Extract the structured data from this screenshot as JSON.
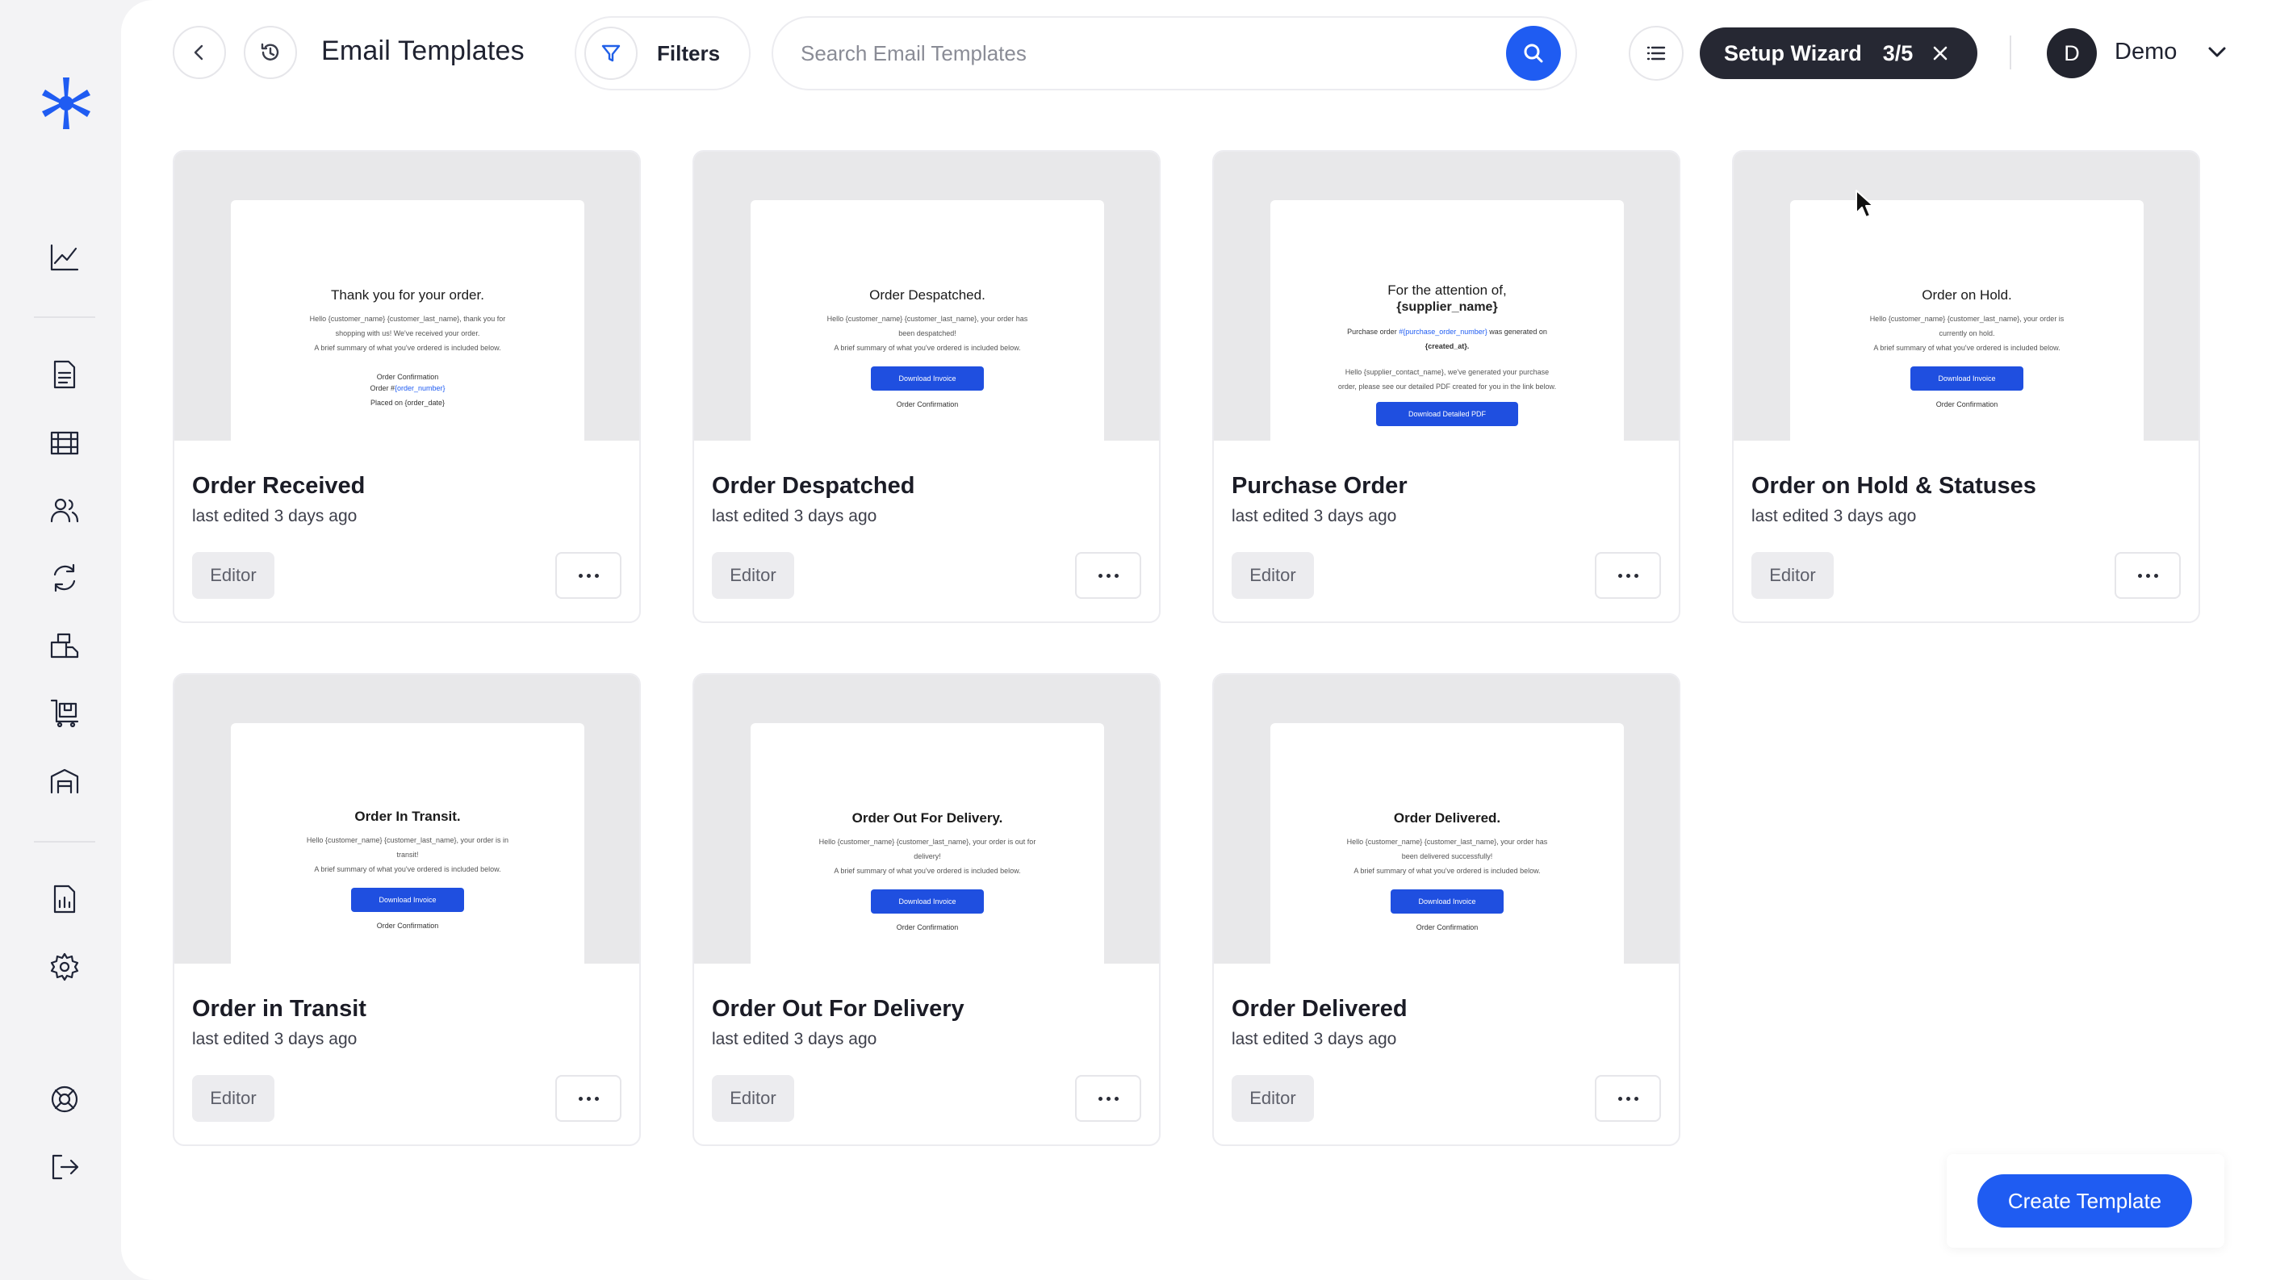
{
  "header": {
    "title": "Email Templates",
    "filters_label": "Filters",
    "search_placeholder": "Search Email Templates",
    "wizard_label": "Setup Wizard",
    "wizard_step": "3/5",
    "user_initial": "D",
    "user_name": "Demo"
  },
  "sidebar": {
    "icons": [
      "logo-icon",
      "analytics-icon",
      "document-icon",
      "dashboard-icon",
      "users-icon",
      "sync-icon",
      "shipping-icon",
      "orders-icon",
      "warehouse-icon",
      "reports-icon",
      "settings-icon",
      "support-icon",
      "logout-icon"
    ]
  },
  "cards": [
    {
      "title": "Order Received",
      "subtitle": "last edited 3 days ago",
      "editor_label": "Editor",
      "preview": {
        "heading": "Thank you for your order.",
        "body_line1": "Hello {customer_name} {customer_last_name}, thank you for",
        "body_line2": "shopping with us! We've received your order.",
        "body_line3": "A brief summary of what you've ordered is included below.",
        "confirm": "Order Confirmation",
        "order_prefix": "Order #",
        "order_link": "{order_number}",
        "placed": "Placed on {order_date}"
      }
    },
    {
      "title": "Order Despatched",
      "subtitle": "last edited 3 days ago",
      "editor_label": "Editor",
      "preview": {
        "heading": "Order Despatched.",
        "body_line1": "Hello {customer_name} {customer_last_name}, your order has",
        "body_line2": "been despatched!",
        "body_line3": "A brief summary of what you've ordered is included below.",
        "button": "Download Invoice",
        "confirm": "Order Confirmation"
      }
    },
    {
      "title": "Purchase Order",
      "subtitle": "last edited 3 days ago",
      "editor_label": "Editor",
      "preview": {
        "heading": "For the attention of,",
        "heading2": "{supplier_name}",
        "po_prefix": "Purchase order ",
        "po_link": "#{purchase_order_number}",
        "po_suffix": " was generated on",
        "po_date": "{created_at}.",
        "body_line1": "Hello {supplier_contact_name}, we've generated your purchase",
        "body_line2": "order, please see our detailed PDF created for you in the link below.",
        "button": "Download Detailed PDF"
      }
    },
    {
      "title": "Order on Hold & Statuses",
      "subtitle": "last edited 3 days ago",
      "editor_label": "Editor",
      "preview": {
        "heading": "Order on Hold.",
        "body_line1": "Hello {customer_name} {customer_last_name}, your order is",
        "body_line2": "currently on hold.",
        "body_line3": "A brief summary of what you've ordered is included below.",
        "button": "Download Invoice",
        "confirm": "Order Confirmation"
      }
    },
    {
      "title": "Order in Transit",
      "subtitle": "last edited 3 days ago",
      "editor_label": "Editor",
      "preview": {
        "heading": "Order In Transit.",
        "body_line1": "Hello {customer_name} {customer_last_name}, your order is in",
        "body_line2": "transit!",
        "body_line3": "A brief summary of what you've ordered is included below.",
        "button": "Download Invoice",
        "confirm": "Order Confirmation"
      }
    },
    {
      "title": "Order Out For Delivery",
      "subtitle": "last edited 3 days ago",
      "editor_label": "Editor",
      "preview": {
        "heading": "Order Out For Delivery.",
        "body_line1": "Hello {customer_name} {customer_last_name}, your order is out for",
        "body_line2": "delivery!",
        "body_line3": "A brief summary of what you've ordered is included below.",
        "button": "Download Invoice",
        "confirm": "Order Confirmation"
      }
    },
    {
      "title": "Order Delivered",
      "subtitle": "last edited 3 days ago",
      "editor_label": "Editor",
      "preview": {
        "heading": "Order Delivered.",
        "body_line1": "Hello {customer_name} {customer_last_name}, your order has",
        "body_line2": "been delivered successfully!",
        "body_line3": "A brief summary of what you've ordered is included below.",
        "button": "Download Invoice",
        "confirm": "Order Confirmation"
      }
    }
  ],
  "create_label": "Create Template",
  "colors": {
    "accent": "#1f5cf2",
    "sidebar_bg": "#f3f3f5",
    "wizard_bg": "#262833",
    "logo": "#1f5cf2"
  }
}
